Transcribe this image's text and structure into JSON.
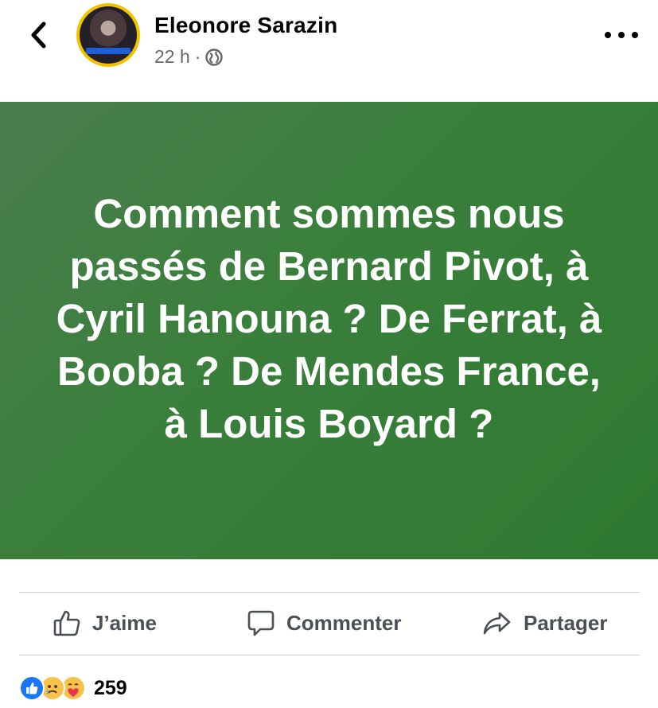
{
  "header": {
    "author_name": "Eleonore Sarazin",
    "time": "22 h",
    "separator": "·",
    "audience_icon": "globe-icon",
    "back_icon": "chevron-left-icon",
    "more_icon": "more-horizontal-icon",
    "avatar_ring_color": "#f2c200"
  },
  "post": {
    "text": "Comment sommes nous passés de Bernard Pivot, à Cyril Hanouna ? De Ferrat, à Booba ? De Mendes France, à Louis Boyard ?",
    "background_color": "#3a7f3c",
    "text_color": "#ffffff"
  },
  "actions": {
    "like_label": "J’aime",
    "comment_label": "Commenter",
    "share_label": "Partager",
    "icons": [
      "thumbs-up-icon",
      "comment-icon",
      "share-icon"
    ]
  },
  "reactions": {
    "types": [
      "like-reaction-icon",
      "sad-reaction-icon",
      "care-reaction-icon"
    ],
    "count": "259"
  }
}
